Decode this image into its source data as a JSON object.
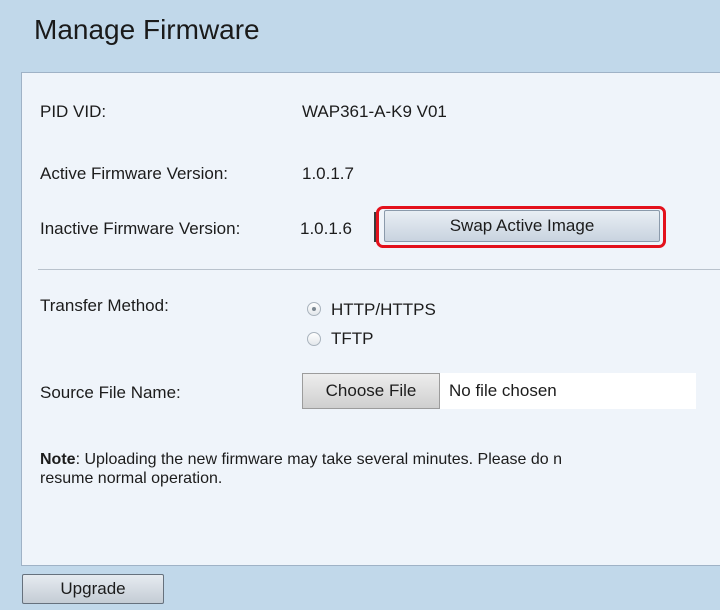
{
  "page": {
    "title": "Manage Firmware"
  },
  "firmware": {
    "pid_vid_label": "PID VID:",
    "pid_vid_value": "WAP361-A-K9 V01",
    "active_label": "Active Firmware Version:",
    "active_value": "1.0.1.7",
    "inactive_label": "Inactive Firmware Version:",
    "inactive_value": "1.0.1.6",
    "swap_button_label": "Swap Active Image"
  },
  "transfer": {
    "label": "Transfer Method:",
    "options": [
      {
        "label": "HTTP/HTTPS",
        "selected": true
      },
      {
        "label": "TFTP",
        "selected": false
      }
    ]
  },
  "source_file": {
    "label": "Source File Name:",
    "button_label": "Choose File",
    "status": "No file chosen"
  },
  "note": {
    "bold": "Note",
    "line1": ": Uploading the new firmware may take several minutes. Please do n",
    "line2": "resume normal operation."
  },
  "actions": {
    "upgrade_label": "Upgrade"
  },
  "colors": {
    "background": "#c1d8ea",
    "panel": "#eff4fa",
    "highlight": "#e3111c"
  }
}
